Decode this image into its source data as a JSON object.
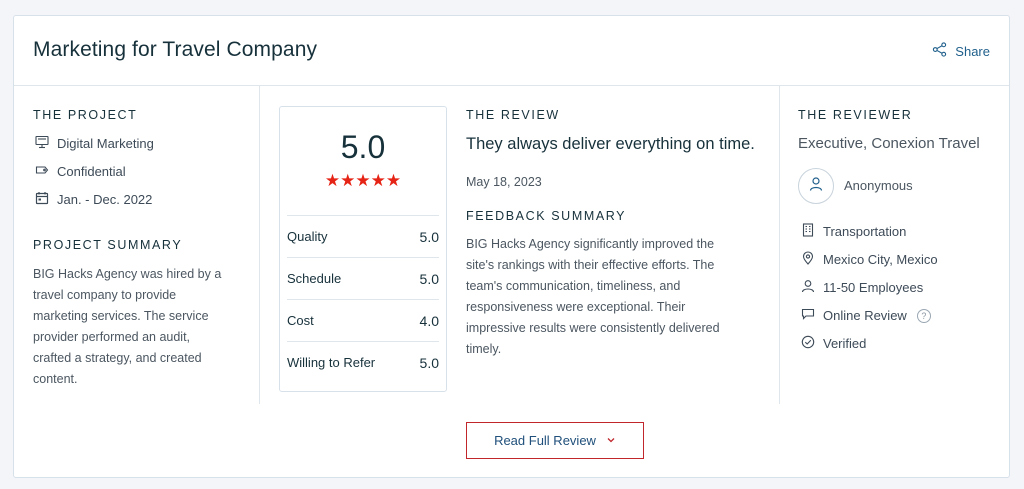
{
  "header": {
    "title": "Marketing for Travel Company",
    "share_label": "Share"
  },
  "project": {
    "section_label": "THE PROJECT",
    "service": "Digital Marketing",
    "budget": "Confidential",
    "dates": "Jan. - Dec. 2022",
    "summary_label": "PROJECT SUMMARY",
    "summary_lines": [
      "BIG Hacks Agency was hired by a",
      "travel company to provide",
      "marketing services. The service",
      "provider performed an audit,",
      "crafted a strategy, and created",
      "content."
    ]
  },
  "rating": {
    "overall": "5.0",
    "stars": "★★★★★",
    "rows": [
      {
        "label": "Quality",
        "value": "5.0"
      },
      {
        "label": "Schedule",
        "value": "5.0"
      },
      {
        "label": "Cost",
        "value": "4.0"
      },
      {
        "label": "Willing to Refer",
        "value": "5.0"
      }
    ]
  },
  "review": {
    "section_label": "THE REVIEW",
    "quote": "They always deliver everything on time.",
    "date": "May 18, 2023",
    "feedback_label": "FEEDBACK SUMMARY",
    "feedback_lines": [
      "BIG Hacks Agency significantly improved the",
      "site's rankings with their effective efforts. The",
      "team's communication, timeliness, and",
      "responsiveness were exceptional. Their",
      "impressive results were consistently delivered",
      "timely."
    ]
  },
  "reviewer": {
    "section_label": "THE REVIEWER",
    "role": "Executive, Conexion Travel",
    "name": "Anonymous",
    "industry": "Transportation",
    "location": "Mexico City, Mexico",
    "employees": "11-50 Employees",
    "review_type": "Online Review",
    "help_glyph": "?",
    "status": "Verified"
  },
  "footer": {
    "read_full_label": "Read Full Review"
  },
  "colors": {
    "accent_red": "#e62415",
    "link_blue": "#1f5f8b",
    "button_border": "#c0262c"
  }
}
